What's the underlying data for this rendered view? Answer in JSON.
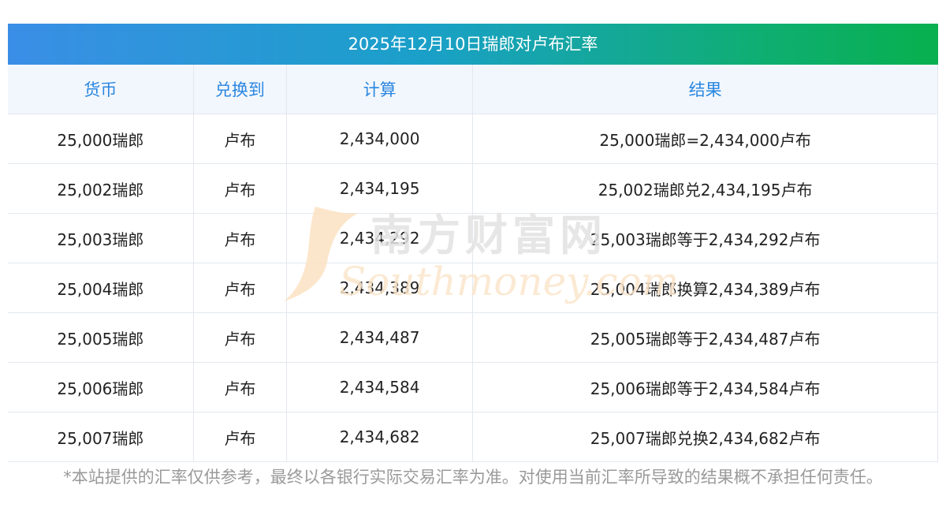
{
  "title": "2025年12月10日瑞郎对卢布汇率",
  "headers": [
    "货币",
    "兑换到",
    "计算",
    "结果"
  ],
  "rows": [
    {
      "currency": "25,000瑞郎",
      "target": "卢布",
      "calc": "2,434,000",
      "result": "25,000瑞郎=2,434,000卢布"
    },
    {
      "currency": "25,002瑞郎",
      "target": "卢布",
      "calc": "2,434,195",
      "result": "25,002瑞郎兑2,434,195卢布"
    },
    {
      "currency": "25,003瑞郎",
      "target": "卢布",
      "calc": "2,434,292",
      "result": "25,003瑞郎等于2,434,292卢布"
    },
    {
      "currency": "25,004瑞郎",
      "target": "卢布",
      "calc": "2,434,389",
      "result": "25,004瑞郎换算2,434,389卢布"
    },
    {
      "currency": "25,005瑞郎",
      "target": "卢布",
      "calc": "2,434,487",
      "result": "25,005瑞郎等于2,434,487卢布"
    },
    {
      "currency": "25,006瑞郎",
      "target": "卢布",
      "calc": "2,434,584",
      "result": "25,006瑞郎等于2,434,584卢布"
    },
    {
      "currency": "25,007瑞郎",
      "target": "卢布",
      "calc": "2,434,682",
      "result": "25,007瑞郎兑换2,434,682卢布"
    }
  ],
  "watermark": {
    "cn": "南方财富网",
    "en": "Southmoney.com"
  },
  "disclaimer": "*本站提供的汇率仅供参考，最终以各银行实际交易汇率为准。对使用当前汇率所导致的结果概不承担任何责任。",
  "colors": {
    "header_text": "#2a86e0",
    "header_bg": "#f2f7fd",
    "title_gradient_start": "#3a8ee6",
    "title_gradient_end": "#08b04e",
    "note_text": "#9a9a9a"
  }
}
